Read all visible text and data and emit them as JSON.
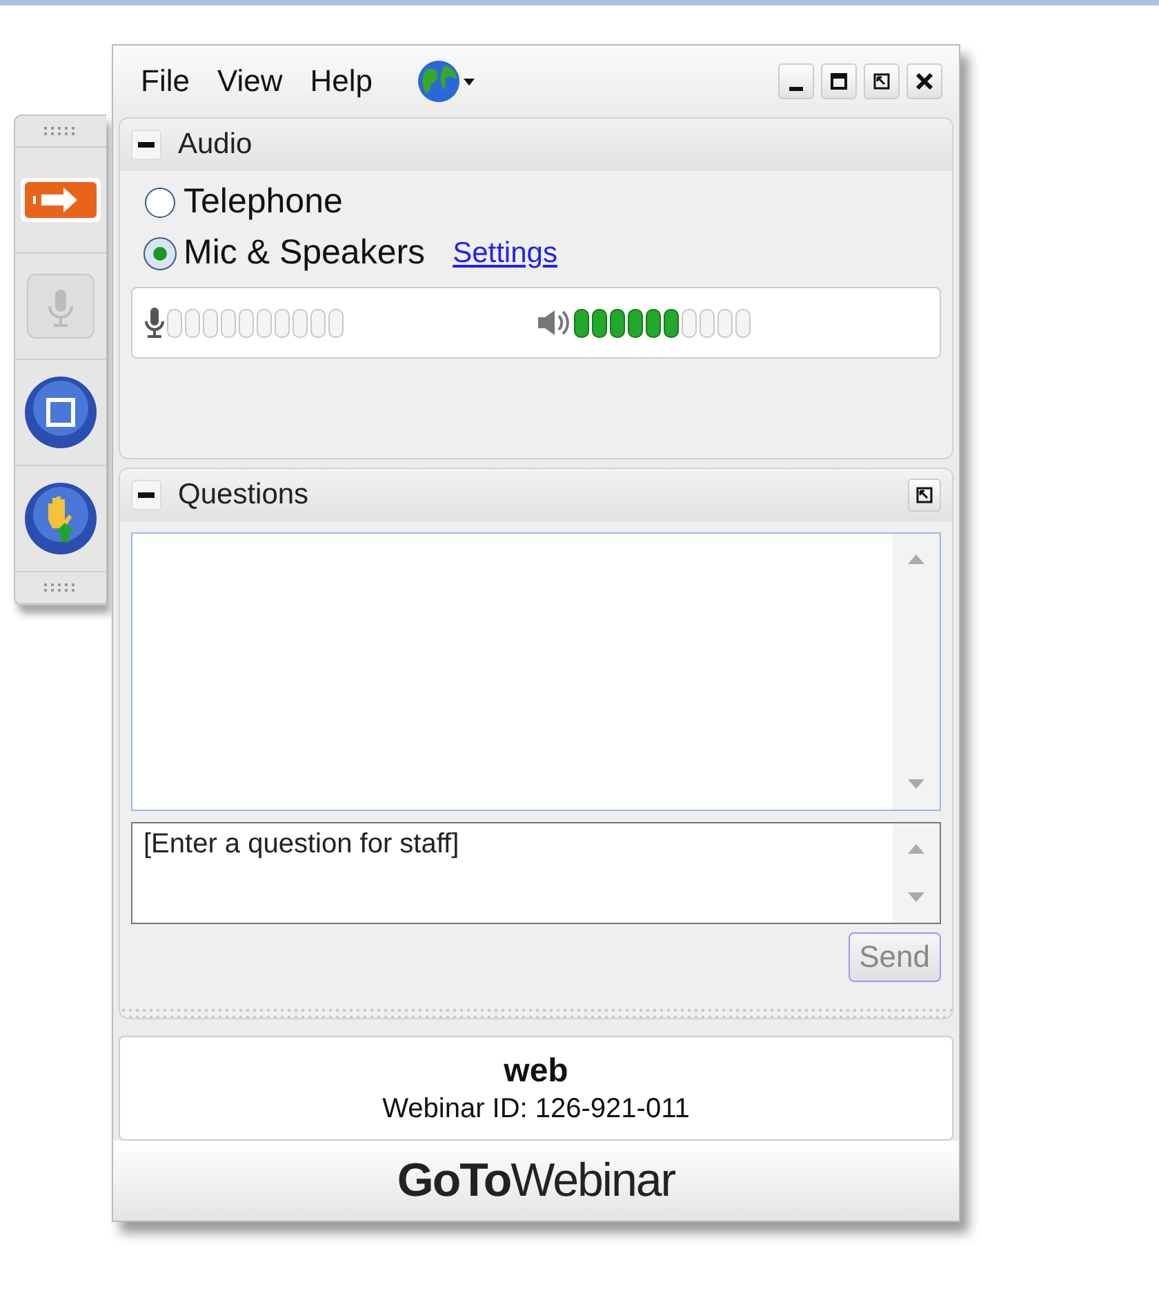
{
  "menu": [
    "File",
    "View",
    "Help"
  ],
  "side_toolbar": [
    {
      "kind": "arrow",
      "selected": true,
      "disabled": false
    },
    {
      "kind": "mic",
      "selected": false,
      "disabled": true
    },
    {
      "kind": "stop",
      "selected": false,
      "disabled": false
    },
    {
      "kind": "hand",
      "selected": false,
      "disabled": false
    }
  ],
  "audio": {
    "title": "Audio",
    "options": [
      {
        "label": "Telephone",
        "selected": false
      },
      {
        "label": "Mic & Speakers",
        "selected": true
      }
    ],
    "settings_link": "Settings",
    "speaker_meter": {
      "level": 0.6
    }
  },
  "questions": {
    "title": "Questions",
    "input": {
      "placeholder": "[Enter a question for staff]"
    },
    "send_button": {
      "label": "Send",
      "disabled": true
    }
  },
  "webinar": {
    "name": "web",
    "id_line": "Webinar ID: 126-921-011"
  },
  "logo": "**GoTo**Webinar"
}
